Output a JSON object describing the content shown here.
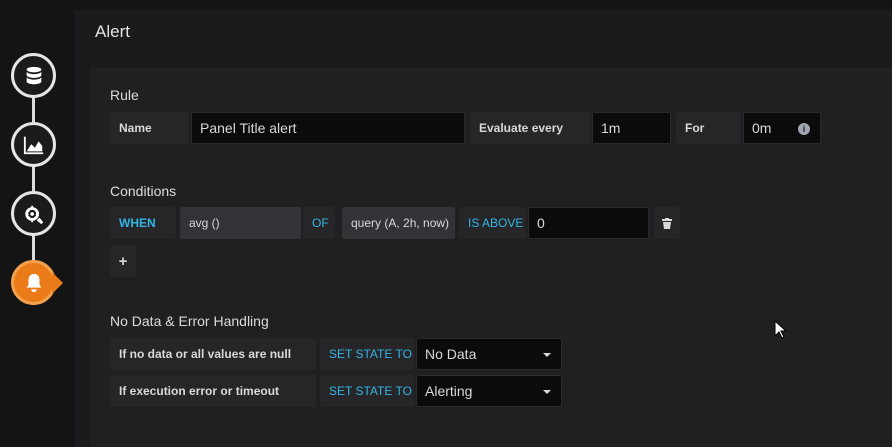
{
  "header": {
    "title": "Alert"
  },
  "rule": {
    "title": "Rule",
    "name_label": "Name",
    "name_value": "Panel Title alert",
    "evaluate_label": "Evaluate every",
    "evaluate_value": "1m",
    "for_label": "For",
    "for_value": "0m"
  },
  "conditions": {
    "title": "Conditions",
    "when_label": "WHEN",
    "reducer": "avg ()",
    "of_label": "OF",
    "query": "query (A, 2h, now)",
    "evaluator": "IS ABOVE",
    "threshold": "0",
    "add_label": "+"
  },
  "no_data": {
    "title": "No Data & Error Handling",
    "rows": [
      {
        "label": "If no data or all values are null",
        "action": "SET STATE TO",
        "value": "No Data"
      },
      {
        "label": "If execution error or timeout",
        "action": "SET STATE TO",
        "value": "Alerting"
      }
    ]
  },
  "icons": {
    "steps": [
      "database-icon",
      "chart-area-icon",
      "gears-icon",
      "bell-icon"
    ],
    "info": "info-icon",
    "delete": "trash-icon"
  },
  "colors": {
    "accent": "#33b5e5",
    "active_step": "#eb7b18"
  }
}
